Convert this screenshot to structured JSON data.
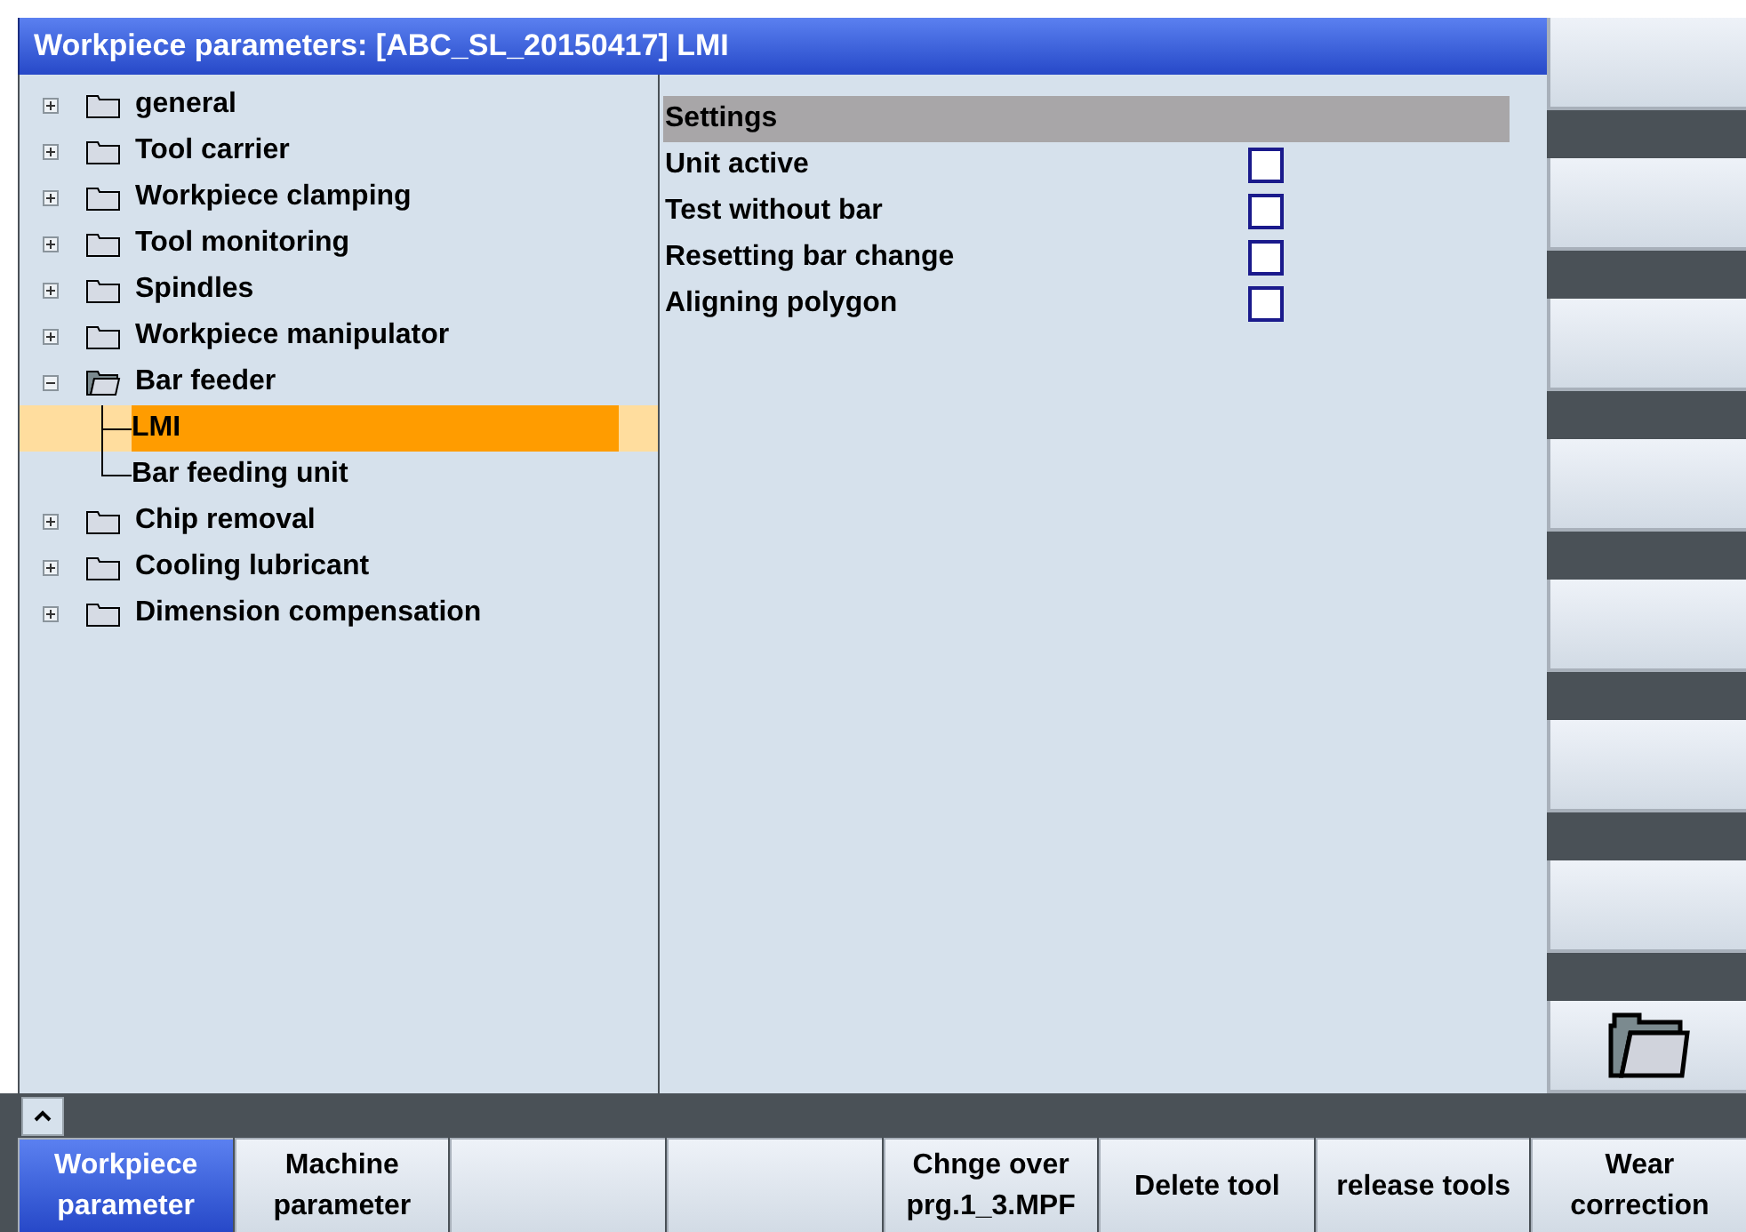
{
  "window": {
    "title": "Workpiece parameters: [ABC_SL_20150417] LMI"
  },
  "tree": [
    {
      "label": "general",
      "expanded": false,
      "selected": false
    },
    {
      "label": "Tool carrier",
      "expanded": false,
      "selected": false
    },
    {
      "label": "Workpiece clamping",
      "expanded": false,
      "selected": false
    },
    {
      "label": "Tool monitoring",
      "expanded": false,
      "selected": false
    },
    {
      "label": "Spindles",
      "expanded": false,
      "selected": false
    },
    {
      "label": "Workpiece manipulator",
      "expanded": false,
      "selected": false
    },
    {
      "label": "Bar feeder",
      "expanded": true,
      "selected": false,
      "children": [
        {
          "label": "LMI",
          "selected": true
        },
        {
          "label": "Bar feeding unit",
          "selected": false
        }
      ]
    },
    {
      "label": "Chip removal",
      "expanded": false,
      "selected": false
    },
    {
      "label": "Cooling lubricant",
      "expanded": false,
      "selected": false
    },
    {
      "label": "Dimension compensation",
      "expanded": false,
      "selected": false
    }
  ],
  "settings": {
    "header": "Settings",
    "rows": [
      {
        "label": "Unit active",
        "checked": false
      },
      {
        "label": "Test without bar",
        "checked": false
      },
      {
        "label": "Resetting bar change",
        "checked": false
      },
      {
        "label": "Aligning polygon",
        "checked": false
      }
    ]
  },
  "side_softkeys": [
    {
      "kind": "blank"
    },
    {
      "kind": "blank"
    },
    {
      "kind": "blank"
    },
    {
      "kind": "blank"
    },
    {
      "kind": "blank"
    },
    {
      "kind": "blank"
    },
    {
      "kind": "blank"
    },
    {
      "kind": "folder"
    }
  ],
  "bottom_softkeys": [
    {
      "label": "Workpiece parameter",
      "selected": true
    },
    {
      "label": "Machine parameter",
      "selected": false
    },
    {
      "selected": false
    },
    {
      "selected": false
    },
    {
      "label": "Chnge over prg.1_3.MPF",
      "selected": false
    },
    {
      "label": "Delete tool",
      "selected": false
    },
    {
      "label": "release tools",
      "selected": false
    },
    {
      "label": "Wear correction",
      "selected": false
    }
  ]
}
